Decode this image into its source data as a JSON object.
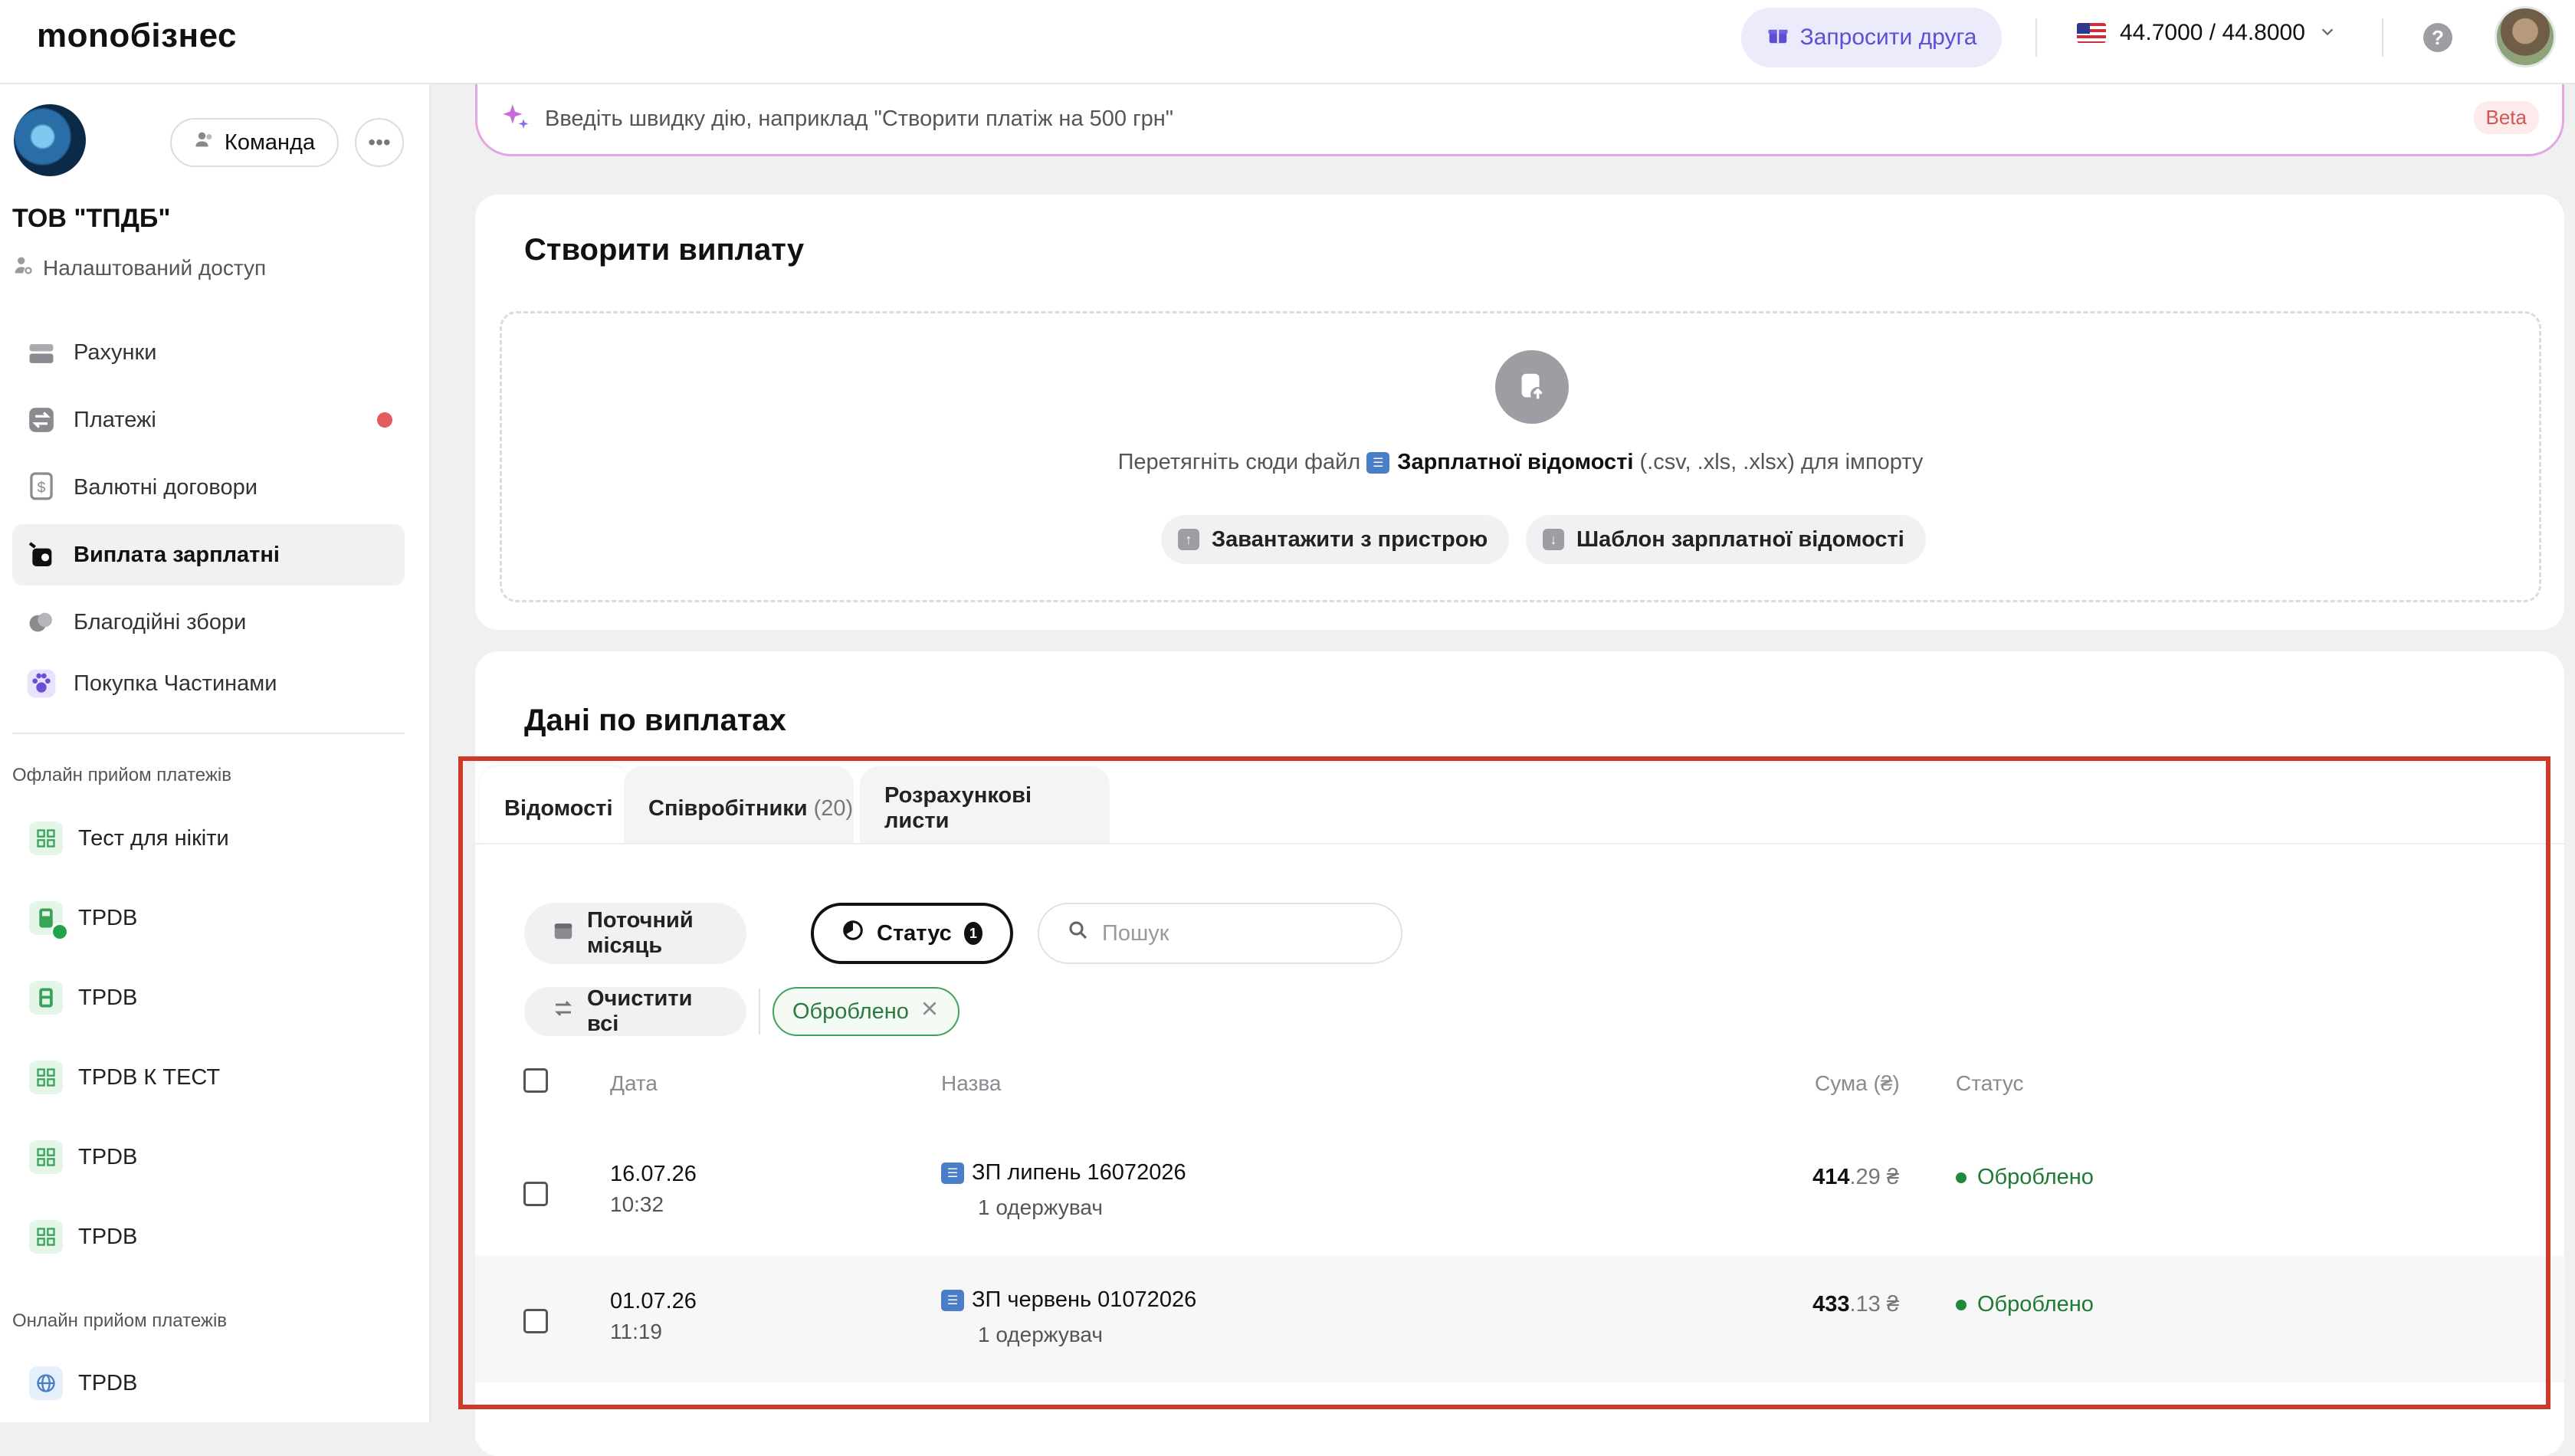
{
  "topbar": {
    "logo": "monoбізнес",
    "invite_label": "Запросити друга",
    "rate": "44.7000 / 44.8000"
  },
  "sidebar": {
    "team_label": "Команда",
    "org_name": "ТОВ \"ТПДБ\"",
    "access_label": "Налаштований доступ",
    "nav": [
      {
        "label": "Рахунки",
        "icon": "wallet-icon"
      },
      {
        "label": "Платежі",
        "icon": "transfer-icon"
      },
      {
        "label": "Валютні договори",
        "icon": "currency-doc-icon"
      },
      {
        "label": "Виплата зарплатні",
        "icon": "salary-icon"
      },
      {
        "label": "Благодійні збори",
        "icon": "charity-icon"
      },
      {
        "label": "Покупка Частинами",
        "icon": "paw-icon"
      }
    ],
    "offline_label": "Офлайн прийом платежів",
    "offline_items": [
      "Тест для нікіти",
      "TPDB",
      "TPDB",
      "TPDB К ТЕСТ",
      "TPDB",
      "TPDB"
    ],
    "online_label": "Онлайн прийом платежів",
    "online_items": [
      "TPDB"
    ]
  },
  "quick_action": {
    "placeholder": "Введіть швидку дію, наприклад \"Створити платіж на 500 грн\"",
    "beta": "Beta"
  },
  "create": {
    "title": "Створити виплату",
    "drop_prefix": "Перетягніть сюди файл",
    "drop_link": "Зарплатної відомості",
    "drop_suffix": "(.csv, .xls, .xlsx) для імпорту",
    "upload_label": "Завантажити з пристрою",
    "template_label": "Шаблон зарплатної відомості"
  },
  "payouts": {
    "title": "Дані по виплатах",
    "tabs": [
      {
        "label": "Відомості",
        "count": ""
      },
      {
        "label": "Співробітники",
        "count": "(20)"
      },
      {
        "label": "Розрахункові листи",
        "count": ""
      }
    ],
    "filters": {
      "period": "Поточний місяць",
      "status": "Статус",
      "status_count": "1",
      "search_placeholder": "Пошук",
      "clear_all": "Очистити всі",
      "active_tag": "Оброблено"
    },
    "columns": {
      "date": "Дата",
      "name": "Назва",
      "sum": "Сума (₴)",
      "status": "Статус"
    },
    "rows": [
      {
        "date": "16.07.26",
        "time": "10:32",
        "name": "ЗП липень 16072026",
        "recipients": "1 одержувач",
        "sum_int": "414",
        "sum_frac": ".29 ₴",
        "status": "Оброблено"
      },
      {
        "date": "01.07.26",
        "time": "11:19",
        "name": "ЗП червень 01072026",
        "recipients": "1 одержувач",
        "sum_int": "433",
        "sum_frac": ".13 ₴",
        "status": "Оброблено"
      }
    ]
  }
}
